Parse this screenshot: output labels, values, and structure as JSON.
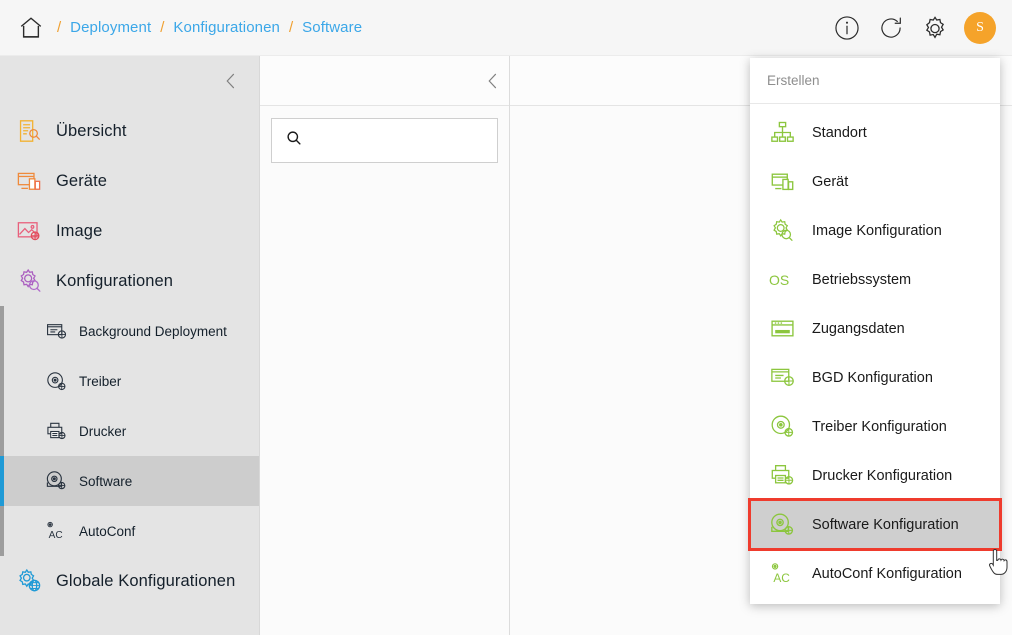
{
  "header": {
    "home_icon": "home-icon",
    "separator": "/",
    "breadcrumbs": [
      {
        "label": "Deployment"
      },
      {
        "label": "Konfigurationen"
      },
      {
        "label": "Software"
      }
    ],
    "actions": [
      {
        "name": "info-icon",
        "label": "i"
      },
      {
        "name": "refresh-icon",
        "label": ""
      },
      {
        "name": "gear-icon",
        "label": ""
      }
    ],
    "avatar_initial": "S",
    "avatar_color": "#f5a32a",
    "link_color": "#3ba7e8",
    "separator_color": "#f0a030"
  },
  "sidebar": {
    "collapse_icon": "chevron-left-icon",
    "items": [
      {
        "label": "Übersicht",
        "icon": "overview-document-search-icon"
      },
      {
        "label": "Geräte",
        "icon": "devices-icon"
      },
      {
        "label": "Image",
        "icon": "image-gear-icon"
      },
      {
        "label": "Konfigurationen",
        "icon": "configurations-gear-icon"
      }
    ],
    "sub_items": [
      {
        "label": "Background Deployment",
        "icon": "background-deployment-icon",
        "active": false
      },
      {
        "label": "Treiber",
        "icon": "driver-disc-icon",
        "active": false
      },
      {
        "label": "Drucker",
        "icon": "printer-icon",
        "active": false
      },
      {
        "label": "Software",
        "icon": "software-disc-icon",
        "active": true
      },
      {
        "label": "AutoConf",
        "icon": "autoconf-icon",
        "active": false
      }
    ],
    "footer_item": {
      "label": "Globale Konfigurationen",
      "icon": "global-configurations-icon"
    },
    "active_accent_color": "#1f9ad6",
    "active_bg_color": "#cdcdcd",
    "bg_color": "#e4e4e4"
  },
  "middle_panel": {
    "collapse_icon": "chevron-left-icon",
    "search": {
      "icon": "search-icon",
      "value": "",
      "placeholder": ""
    }
  },
  "right_panel": {
    "back_icon": "chevron-left-icon"
  },
  "dropdown": {
    "title": "Erstellen",
    "highlight_border_color": "#ef3b2d",
    "highlight_bg_color": "#cfcfcf",
    "icon_color": "#8cc63e",
    "items": [
      {
        "label": "Standort",
        "icon": "sitemap-icon",
        "highlighted": false
      },
      {
        "label": "Gerät",
        "icon": "devices-icon",
        "highlighted": false
      },
      {
        "label": "Image Konfiguration",
        "icon": "image-gear-icon",
        "highlighted": false
      },
      {
        "label": "Betriebssystem",
        "icon": "os-text-icon",
        "highlighted": false
      },
      {
        "label": "Zugangsdaten",
        "icon": "credentials-card-icon",
        "highlighted": false
      },
      {
        "label": "BGD Konfiguration",
        "icon": "bgd-config-icon",
        "highlighted": false
      },
      {
        "label": "Treiber Konfiguration",
        "icon": "driver-disc-icon",
        "highlighted": false
      },
      {
        "label": "Drucker Konfiguration",
        "icon": "printer-icon",
        "highlighted": false
      },
      {
        "label": "Software Konfiguration",
        "icon": "software-disc-icon",
        "highlighted": true
      },
      {
        "label": "AutoConf Konfiguration",
        "icon": "autoconf-icon",
        "highlighted": false
      }
    ]
  },
  "cursor": {
    "icon": "pointing-hand-cursor"
  }
}
